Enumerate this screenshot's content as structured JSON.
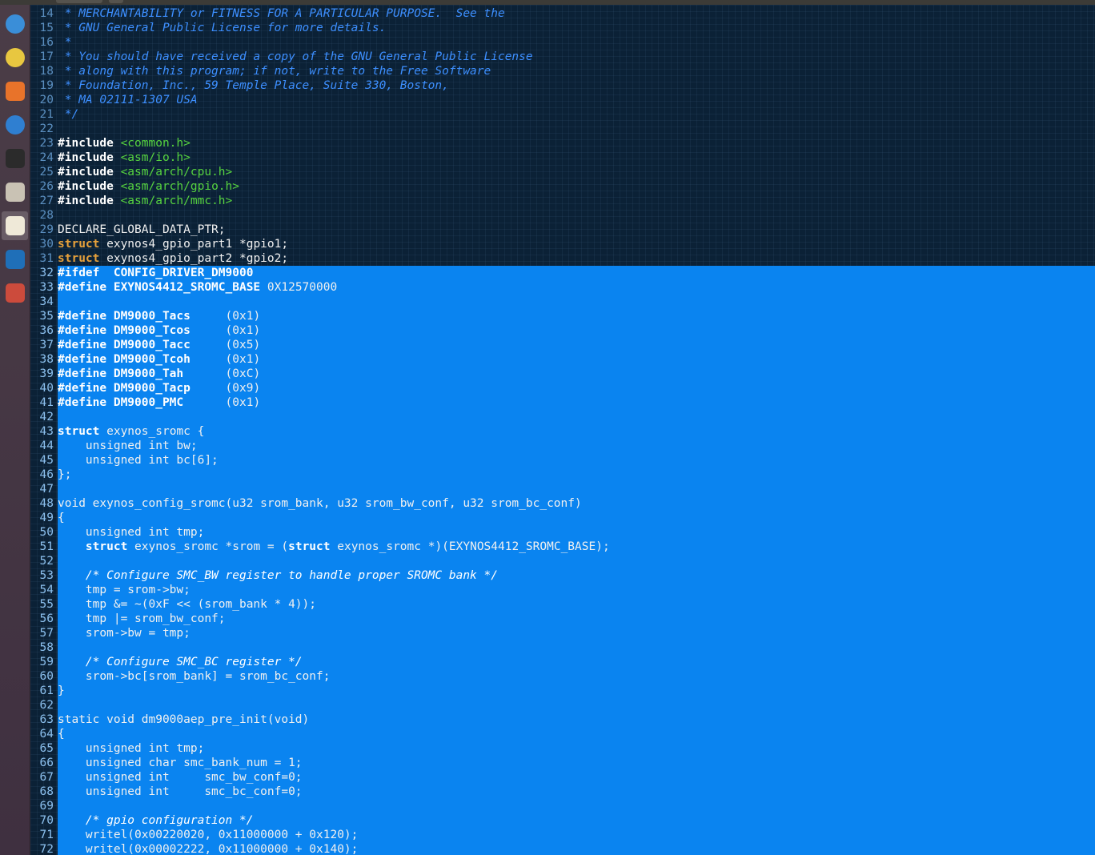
{
  "launcher": {
    "items": [
      {
        "name": "thunderbird-icon",
        "color": "#3a8ed8"
      },
      {
        "name": "rhythmbox-icon",
        "color": "#e8c740"
      },
      {
        "name": "software-center-icon",
        "color": "#e8732a"
      },
      {
        "name": "help-icon",
        "color": "#2f7fd1"
      },
      {
        "name": "terminal-icon",
        "color": "#2b2b2b"
      },
      {
        "name": "archive-manager-icon",
        "color": "#c9c2b4"
      },
      {
        "name": "text-editor-icon",
        "color": "#efe9d8"
      },
      {
        "name": "system-monitor-icon",
        "color": "#1f6fb8"
      },
      {
        "name": "system-settings-icon",
        "color": "#cc4b3c"
      }
    ]
  },
  "editor": {
    "lines": [
      {
        "n": "14",
        "text": " * MERCHANTABILITY or FITNESS FOR A PARTICULAR PURPOSE.  See the",
        "kind": "comment",
        "sel": false
      },
      {
        "n": "15",
        "text": " * GNU General Public License for more details.",
        "kind": "comment",
        "sel": false
      },
      {
        "n": "16",
        "text": " *",
        "kind": "comment",
        "sel": false
      },
      {
        "n": "17",
        "text": " * You should have received a copy of the GNU General Public License",
        "kind": "comment",
        "sel": false
      },
      {
        "n": "18",
        "text": " * along with this program; if not, write to the Free Software",
        "kind": "comment",
        "sel": false
      },
      {
        "n": "19",
        "text": " * Foundation, Inc., 59 Temple Place, Suite 330, Boston,",
        "kind": "comment",
        "sel": false
      },
      {
        "n": "20",
        "text": " * MA 02111-1307 USA",
        "kind": "comment",
        "sel": false
      },
      {
        "n": "21",
        "text": " */",
        "kind": "comment",
        "sel": false
      },
      {
        "n": "22",
        "text": "",
        "kind": "plain",
        "sel": false
      },
      {
        "n": "23",
        "text": "#include <common.h>",
        "kind": "include",
        "sel": false
      },
      {
        "n": "24",
        "text": "#include <asm/io.h>",
        "kind": "include",
        "sel": false
      },
      {
        "n": "25",
        "text": "#include <asm/arch/cpu.h>",
        "kind": "include",
        "sel": false
      },
      {
        "n": "26",
        "text": "#include <asm/arch/gpio.h>",
        "kind": "include",
        "sel": false
      },
      {
        "n": "27",
        "text": "#include <asm/arch/mmc.h>",
        "kind": "include",
        "sel": false
      },
      {
        "n": "28",
        "text": "",
        "kind": "plain",
        "sel": false
      },
      {
        "n": "29",
        "text": "DECLARE_GLOBAL_DATA_PTR;",
        "kind": "plain",
        "sel": false
      },
      {
        "n": "30",
        "text": "struct exynos4_gpio_part1 *gpio1;",
        "kind": "struct",
        "sel": false
      },
      {
        "n": "31",
        "text": "struct exynos4_gpio_part2 *gpio2;",
        "kind": "struct",
        "sel": false
      },
      {
        "n": "32",
        "text": "#ifdef  CONFIG_DRIVER_DM9000",
        "kind": "preproc",
        "sel": true
      },
      {
        "n": "33",
        "text": "#define EXYNOS4412_SROMC_BASE 0X12570000",
        "kind": "preproc",
        "sel": true
      },
      {
        "n": "34",
        "text": "",
        "kind": "plain",
        "sel": true
      },
      {
        "n": "35",
        "text": "#define DM9000_Tacs     (0x1)",
        "kind": "preproc",
        "sel": true
      },
      {
        "n": "36",
        "text": "#define DM9000_Tcos     (0x1)",
        "kind": "preproc",
        "sel": true
      },
      {
        "n": "37",
        "text": "#define DM9000_Tacc     (0x5)",
        "kind": "preproc",
        "sel": true
      },
      {
        "n": "38",
        "text": "#define DM9000_Tcoh     (0x1)",
        "kind": "preproc",
        "sel": true
      },
      {
        "n": "39",
        "text": "#define DM9000_Tah      (0xC)",
        "kind": "preproc",
        "sel": true
      },
      {
        "n": "40",
        "text": "#define DM9000_Tacp     (0x9)",
        "kind": "preproc",
        "sel": true
      },
      {
        "n": "41",
        "text": "#define DM9000_PMC      (0x1)",
        "kind": "preproc",
        "sel": true
      },
      {
        "n": "42",
        "text": "",
        "kind": "plain",
        "sel": true
      },
      {
        "n": "43",
        "text": "struct exynos_sromc {",
        "kind": "struct",
        "sel": true
      },
      {
        "n": "44",
        "text": "    unsigned int bw;",
        "kind": "plain",
        "sel": true
      },
      {
        "n": "45",
        "text": "    unsigned int bc[6];",
        "kind": "plain",
        "sel": true
      },
      {
        "n": "46",
        "text": "};",
        "kind": "plain",
        "sel": true
      },
      {
        "n": "47",
        "text": "",
        "kind": "plain",
        "sel": true
      },
      {
        "n": "48",
        "text": "void exynos_config_sromc(u32 srom_bank, u32 srom_bw_conf, u32 srom_bc_conf)",
        "kind": "plain",
        "sel": true
      },
      {
        "n": "49",
        "text": "{",
        "kind": "plain",
        "sel": true
      },
      {
        "n": "50",
        "text": "    unsigned int tmp;",
        "kind": "plain",
        "sel": true
      },
      {
        "n": "51",
        "text": "    struct exynos_sromc *srom = (struct exynos_sromc *)(EXYNOS4412_SROMC_BASE);",
        "kind": "struct2",
        "sel": true
      },
      {
        "n": "52",
        "text": "",
        "kind": "plain",
        "sel": true
      },
      {
        "n": "53",
        "text": "    /* Configure SMC_BW register to handle proper SROMC bank */",
        "kind": "comment",
        "sel": true
      },
      {
        "n": "54",
        "text": "    tmp = srom->bw;",
        "kind": "plain",
        "sel": true
      },
      {
        "n": "55",
        "text": "    tmp &= ~(0xF << (srom_bank * 4));",
        "kind": "plain",
        "sel": true
      },
      {
        "n": "56",
        "text": "    tmp |= srom_bw_conf;",
        "kind": "plain",
        "sel": true
      },
      {
        "n": "57",
        "text": "    srom->bw = tmp;",
        "kind": "plain",
        "sel": true
      },
      {
        "n": "58",
        "text": "",
        "kind": "plain",
        "sel": true
      },
      {
        "n": "59",
        "text": "    /* Configure SMC_BC register */",
        "kind": "comment",
        "sel": true
      },
      {
        "n": "60",
        "text": "    srom->bc[srom_bank] = srom_bc_conf;",
        "kind": "plain",
        "sel": true
      },
      {
        "n": "61",
        "text": "}",
        "kind": "plain",
        "sel": true
      },
      {
        "n": "62",
        "text": "",
        "kind": "plain",
        "sel": true
      },
      {
        "n": "63",
        "text": "static void dm9000aep_pre_init(void)",
        "kind": "plain",
        "sel": true
      },
      {
        "n": "64",
        "text": "{",
        "kind": "plain",
        "sel": true
      },
      {
        "n": "65",
        "text": "    unsigned int tmp;",
        "kind": "plain",
        "sel": true
      },
      {
        "n": "66",
        "text": "    unsigned char smc_bank_num = 1;",
        "kind": "plain",
        "sel": true
      },
      {
        "n": "67",
        "text": "    unsigned int     smc_bw_conf=0;",
        "kind": "plain",
        "sel": true
      },
      {
        "n": "68",
        "text": "    unsigned int     smc_bc_conf=0;",
        "kind": "plain",
        "sel": true
      },
      {
        "n": "69",
        "text": "",
        "kind": "plain",
        "sel": true
      },
      {
        "n": "70",
        "text": "    /* gpio configuration */",
        "kind": "comment",
        "sel": true
      },
      {
        "n": "71",
        "text": "    writel(0x00220020, 0x11000000 + 0x120);",
        "kind": "plain",
        "sel": true
      },
      {
        "n": "72",
        "text": "    writel(0x00002222, 0x11000000 + 0x140);",
        "kind": "plain",
        "sel": true
      }
    ]
  }
}
